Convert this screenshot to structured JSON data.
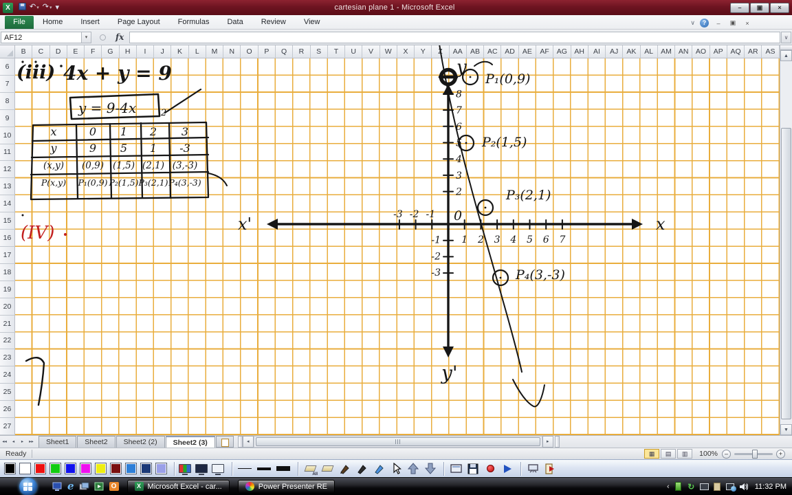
{
  "titlebar": {
    "title": "cartesian plane 1  -  Microsoft Excel"
  },
  "ribbon": {
    "tabs": [
      "File",
      "Home",
      "Insert",
      "Page Layout",
      "Formulas",
      "Data",
      "Review",
      "View"
    ]
  },
  "formula_bar": {
    "name_box": "AF12",
    "fx_label": "fx",
    "formula_value": ""
  },
  "grid": {
    "gridline_color": "#e9ad3c",
    "columns": [
      "B",
      "C",
      "D",
      "E",
      "F",
      "G",
      "H",
      "I",
      "J",
      "K",
      "L",
      "M",
      "N",
      "O",
      "P",
      "Q",
      "R",
      "S",
      "T",
      "U",
      "V",
      "W",
      "X",
      "Y",
      "Z",
      "AA",
      "AB",
      "AC",
      "AD",
      "AE",
      "AF",
      "AG",
      "AH",
      "AI",
      "AJ",
      "AK",
      "AL",
      "AM",
      "AN",
      "AO",
      "AP",
      "AQ",
      "AR",
      "AS"
    ],
    "rows": [
      "6",
      "7",
      "8",
      "9",
      "10",
      "11",
      "12",
      "13",
      "14",
      "15",
      "16",
      "17",
      "18",
      "19",
      "20",
      "21",
      "22",
      "23",
      "24",
      "25",
      "26",
      "27"
    ]
  },
  "whiteboard": {
    "ink_color": "#161616",
    "red_ink": "#c22020",
    "equation_label": "(iii)",
    "equation": "4x + y = 9",
    "boxed_equation": "y = 9-4x",
    "box_note": "2",
    "section_label": "(IV)",
    "table": {
      "rows": [
        [
          "x",
          "0",
          "1",
          "2",
          "3"
        ],
        [
          "y",
          "9",
          "5",
          "1",
          "-3"
        ],
        [
          "(x,y)",
          "(0,9)",
          "(1,5)",
          "(2,1)",
          "(3,-3)"
        ],
        [
          "P(x,y)",
          "P₁(0,9)",
          "P₂(1,5)",
          "P₃(2,1)",
          "P₄(3,-3)"
        ]
      ]
    },
    "plane": {
      "x_label": "x",
      "x_prime_label": "x'",
      "y_label": "y",
      "y_prime_label": "y'",
      "origin_label": "0",
      "y_ticks_pos": [
        "8",
        "7",
        "6",
        "5",
        "4",
        "3",
        "2"
      ],
      "y_ticks_neg": [
        "-1",
        "-2",
        "-3"
      ],
      "x_ticks_neg": [
        "-3",
        "-2",
        "-1"
      ],
      "x_ticks_pos": [
        "1",
        "2",
        "3",
        "4",
        "5",
        "6",
        "7"
      ],
      "points": [
        {
          "label": "P₁(0,9)",
          "x": 0,
          "y": 9
        },
        {
          "label": "P₂(1,5)",
          "x": 1,
          "y": 5
        },
        {
          "label": "P₃(2,1)",
          "x": 2,
          "y": 1
        },
        {
          "label": "P₄(3,-3)",
          "x": 3,
          "y": -3
        }
      ]
    }
  },
  "sheet_tabs": {
    "tabs": [
      {
        "label": "Sheet1",
        "active": false
      },
      {
        "label": "Sheet2",
        "active": false
      },
      {
        "label": "Sheet2 (2)",
        "active": false
      },
      {
        "label": "Sheet2 (3)",
        "active": true
      }
    ]
  },
  "status_bar": {
    "mode": "Ready",
    "zoom_level": "100%"
  },
  "draw_toolbar": {
    "colors": [
      "#000000",
      "#ffffff",
      "#ee1111",
      "#11cc11",
      "#1111ee",
      "#ee11ee",
      "#eeee11",
      "#7a1010",
      "#2e7fd8",
      "#1c3a78",
      "#9aa0e8"
    ],
    "eraser_all_label": "All"
  },
  "taskbar": {
    "quick_launch_icons": [
      "display",
      "internet-explorer",
      "show-desktop",
      "media-app",
      "outlook"
    ],
    "buttons": [
      {
        "label": "Microsoft Excel - car...",
        "icon": "excel",
        "active": false
      },
      {
        "label": "Power Presenter RE",
        "icon": "power-presenter",
        "active": true
      }
    ],
    "clock": "11:32 PM"
  }
}
